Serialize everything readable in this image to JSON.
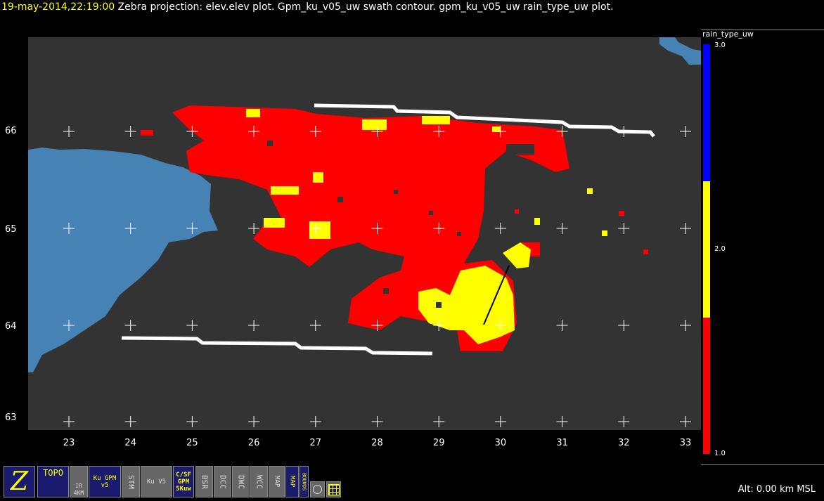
{
  "title": {
    "timestamp": "19-may-2014,22:19:00",
    "description": "Zebra projection: elev.elev  plot.  Gpm_ku_v05_uw swath contour.  gpm_ku_v05_uw rain_type_uw  plot."
  },
  "axes": {
    "x_labels": [
      "23",
      "24",
      "25",
      "26",
      "27",
      "28",
      "29",
      "30",
      "31",
      "32",
      "33"
    ],
    "y_labels": [
      "66",
      "65",
      "64",
      "63"
    ]
  },
  "colorbar": {
    "title": "rain_type_uw",
    "labels": [
      "3.0",
      "2.0",
      "1.0"
    ],
    "colors": {
      "high": "#0000ff",
      "mid": "#ffff00",
      "low": "#ff0000"
    }
  },
  "colors": {
    "background": "#333333",
    "land": "#4682b4",
    "swath": "#ffffff"
  },
  "toolbar": [
    {
      "name": "zebra-logo",
      "label": "Z"
    },
    {
      "name": "topo",
      "label": "TOPO"
    },
    {
      "name": "ir-4km",
      "label": "IR 4KM"
    },
    {
      "name": "ku-gpm-v5",
      "label": "Ku GPM v5"
    },
    {
      "name": "stm",
      "label": "STM"
    },
    {
      "name": "ku-v5",
      "label": "Ku V5"
    },
    {
      "name": "csf-gpm",
      "label": "C/SF GPM 5Kuw"
    },
    {
      "name": "bsr",
      "label": "BSR"
    },
    {
      "name": "dcc",
      "label": "DCC"
    },
    {
      "name": "dwc",
      "label": "DWC"
    },
    {
      "name": "wcc",
      "label": "WCC"
    },
    {
      "name": "map-gray",
      "label": "MAP"
    },
    {
      "name": "map-blue",
      "label": "MAP"
    },
    {
      "name": "bounds",
      "label": "BOUNDS"
    }
  ],
  "status": {
    "altitude": "Alt: 0.00 km MSL"
  }
}
